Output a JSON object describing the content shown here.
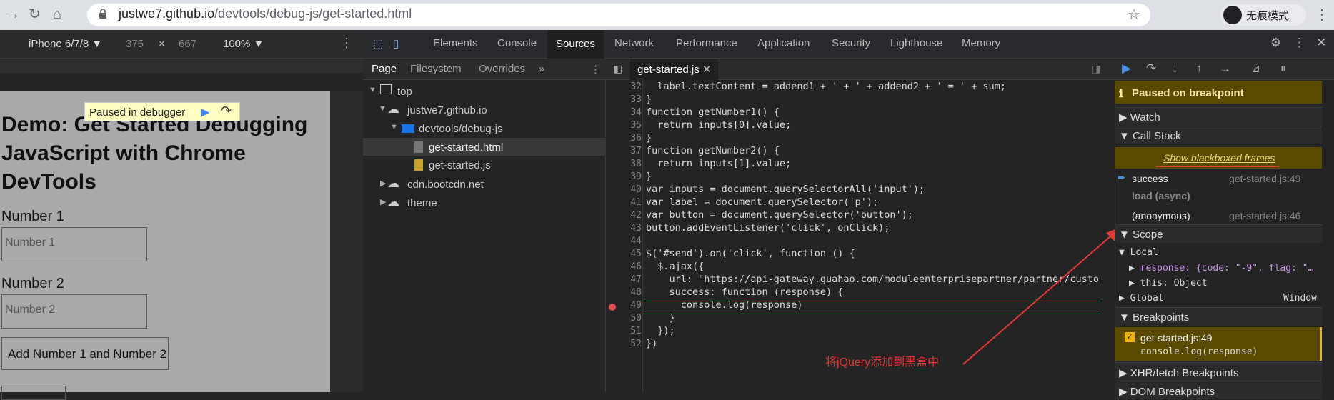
{
  "browser": {
    "url_host": "justwe7.github.io",
    "url_path": "/devtools/debug-js/get-started.html",
    "incognito_label": "无痕模式"
  },
  "device_toolbar": {
    "device": "iPhone 6/7/8 ▼",
    "width": "375",
    "times": "×",
    "height": "667",
    "zoom": "100% ▼"
  },
  "page": {
    "heading": "Demo: Get Started Debugging JavaScript with Chrome DevTools",
    "label1": "Number 1",
    "input1_placeholder": "Number 1",
    "label2": "Number 2",
    "input2_placeholder": "Number 2",
    "button": "Add Number 1 and Number 2",
    "paused_text": "Paused in debugger"
  },
  "devtools": {
    "tabs": [
      "Elements",
      "Console",
      "Sources",
      "Network",
      "Performance",
      "Application",
      "Security",
      "Lighthouse",
      "Memory"
    ],
    "navigator_tabs": [
      "Page",
      "Filesystem",
      "Overrides",
      "»"
    ],
    "tree": [
      "top",
      "justwe7.github.io",
      "devtools/debug-js",
      "get-started.html",
      "get-started.js",
      "cdn.bootcdn.net",
      "theme"
    ],
    "editor_tab": "get-started.js",
    "code_lines": [
      {
        "n": "32",
        "t": "  label.textContent = addend1 + ' + ' + addend2 + ' = ' + sum;"
      },
      {
        "n": "33",
        "t": "}"
      },
      {
        "n": "34",
        "t": "function getNumber1() {"
      },
      {
        "n": "35",
        "t": "  return inputs[0].value;"
      },
      {
        "n": "36",
        "t": "}"
      },
      {
        "n": "37",
        "t": "function getNumber2() {"
      },
      {
        "n": "38",
        "t": "  return inputs[1].value;"
      },
      {
        "n": "39",
        "t": "}"
      },
      {
        "n": "40",
        "t": "var inputs = document.querySelectorAll('input');"
      },
      {
        "n": "41",
        "t": "var label = document.querySelector('p');"
      },
      {
        "n": "42",
        "t": "var button = document.querySelector('button');"
      },
      {
        "n": "43",
        "t": "button.addEventListener('click', onClick);"
      },
      {
        "n": "44",
        "t": ""
      },
      {
        "n": "45",
        "t": "$('#send').on('click', function () {"
      },
      {
        "n": "46",
        "t": "  $.ajax({"
      },
      {
        "n": "47",
        "t": "    url: \"https://api-gateway.guahao.com/moduleenterprisepartner/partner/custo"
      },
      {
        "n": "48",
        "t": "    success: function (response) {"
      },
      {
        "n": "49",
        "t": "      console.log(response)"
      },
      {
        "n": "50",
        "t": "    }"
      },
      {
        "n": "51",
        "t": "  });"
      },
      {
        "n": "52",
        "t": "})"
      }
    ],
    "annotation": "将jQuery添加到黑盒中",
    "debugger": {
      "paused": "Paused on breakpoint",
      "watch": "Watch",
      "call_stack": "Call Stack",
      "show_blackboxed": "Show blackboxed frames",
      "frames": [
        {
          "name": "success",
          "loc": "get-started.js:49"
        },
        {
          "name": "load (async)",
          "loc": ""
        },
        {
          "name": "(anonymous)",
          "loc": "get-started.js:46"
        }
      ],
      "scope": "Scope",
      "local": "Local",
      "response_line": "response: {code: \"-9\", flag: \"…",
      "this_line": "this: Object",
      "global": "Global",
      "global_value": "Window",
      "breakpoints": "Breakpoints",
      "bp_file": "get-started.js:49",
      "bp_code": "console.log(response)",
      "xhr": "XHR/fetch Breakpoints",
      "dom": "DOM Breakpoints"
    }
  },
  "colors": {
    "accent": "#5a4a00",
    "annotation": "#e53935"
  }
}
